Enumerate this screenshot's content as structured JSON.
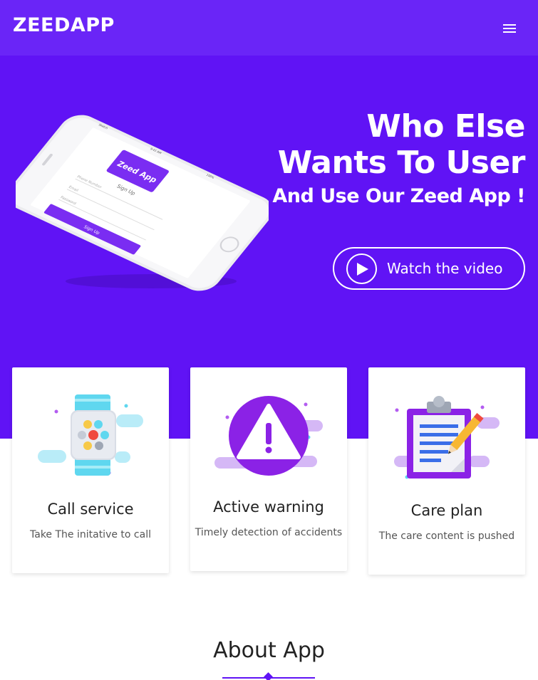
{
  "header": {
    "brand": "ZEEDAPP",
    "menu_icon": "hamburger-menu-icon"
  },
  "hero": {
    "title_line1": "Who Else",
    "title_line2": "Wants To User",
    "subtitle": "And Use Our Zeed App !",
    "video_button_label": "Watch the video",
    "video_icon": "play-icon",
    "background_color": "#6013f5"
  },
  "phone_mockup": {
    "app_badge": "Zeed App",
    "heading": "Sign Up",
    "field_phone": "Phone Number",
    "field_email": "Email",
    "field_password": "Password",
    "button": "Sign Up",
    "status_left": "Sketch",
    "status_time": "9:41 AM",
    "status_right": "100%"
  },
  "features": [
    {
      "title": "Call service",
      "text": "Take The initative to call",
      "icon": "smartwatch-icon"
    },
    {
      "title": "Active warning",
      "text": "Timely detection of accidents",
      "icon": "warning-icon"
    },
    {
      "title": "Care plan",
      "text": "The care content is pushed",
      "icon": "clipboard-icon"
    }
  ],
  "about": {
    "title": "About App"
  },
  "colors": {
    "primary": "#6013f5",
    "navbar": "#6a25f7",
    "accent_cyan": "#5fd7ef",
    "accent_purple": "#8b22e6"
  }
}
